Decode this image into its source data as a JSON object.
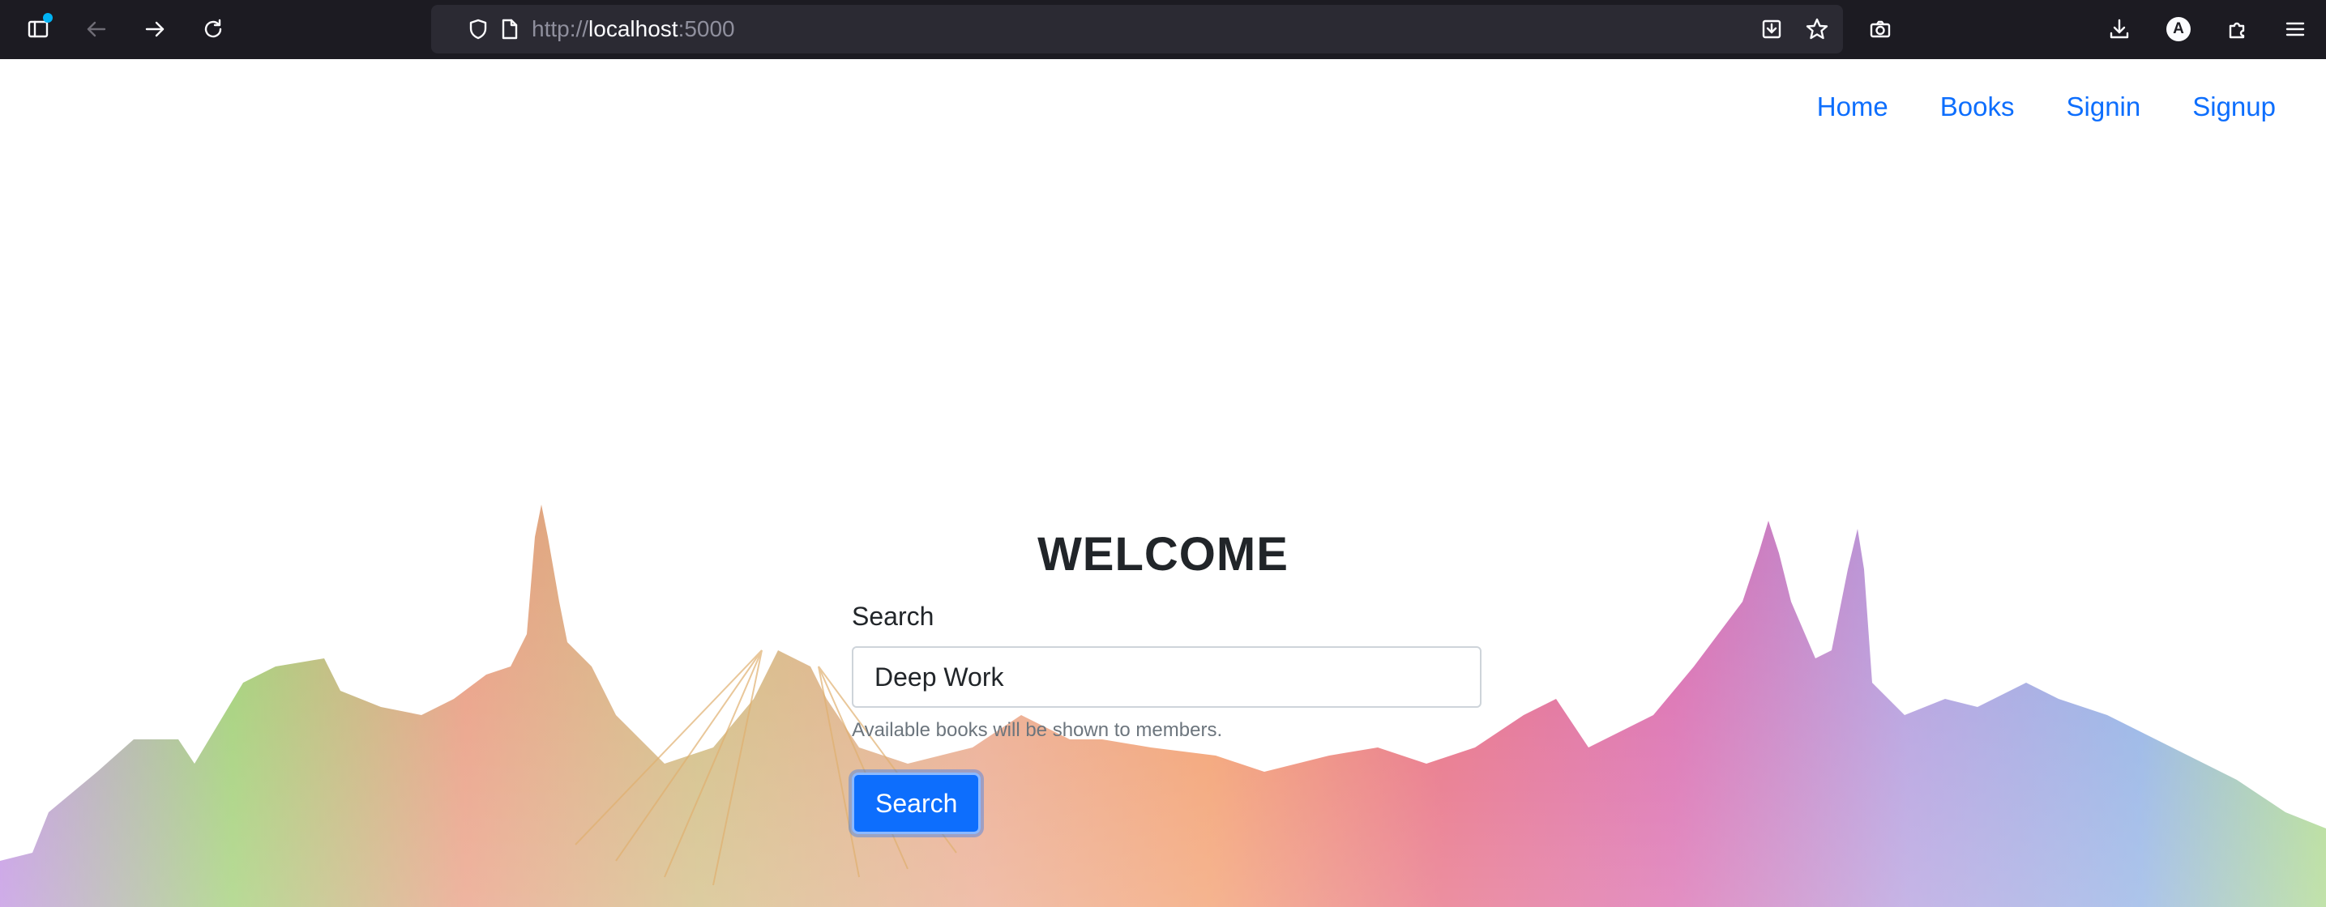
{
  "browser": {
    "url_scheme": "http://",
    "url_host": "localhost",
    "url_port": ":5000",
    "profile_initial": "A"
  },
  "nav": {
    "items": [
      "Home",
      "Books",
      "Signin",
      "Signup"
    ]
  },
  "hero": {
    "title": "WELCOME"
  },
  "search": {
    "label": "Search",
    "value": "Deep Work",
    "help_text": "Available books will be shown to members.",
    "button_label": "Search"
  },
  "colors": {
    "link": "#0d6efd",
    "button": "#0d6efd",
    "browser_bg": "#1c1b22"
  }
}
